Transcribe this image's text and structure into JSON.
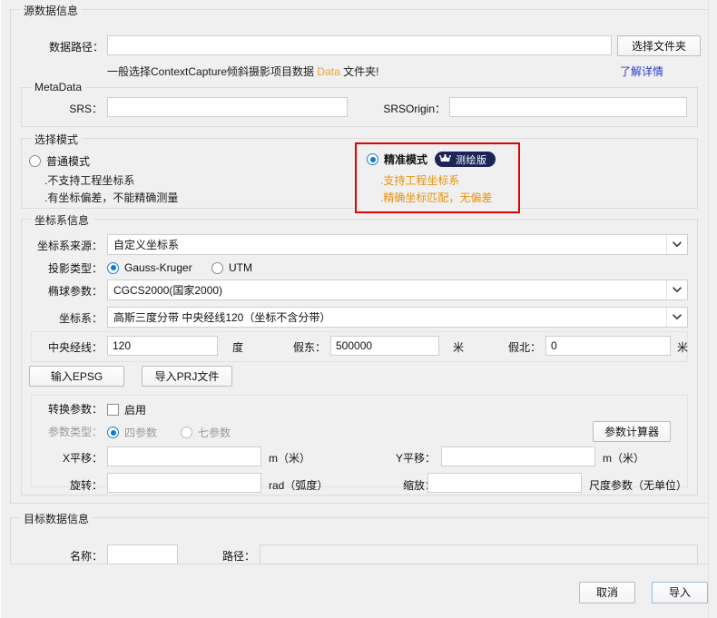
{
  "source_group": {
    "legend": "源数据信息",
    "data_path_label": "数据路径：",
    "data_path_value": "",
    "choose_folder_button": "选择文件夹",
    "hint_prefix": "一般选择ContextCapture倾斜摄影项目数据 ",
    "hint_accent": "Data",
    "hint_suffix": " 文件夹!",
    "learn_more_link": "了解详情",
    "metadata": {
      "legend": "MetaData",
      "srs_label": "SRS：",
      "srs_value": "",
      "srsorigin_label": "SRSOrigin：",
      "srsorigin_value": ""
    },
    "mode": {
      "legend": "选择模式",
      "normal": {
        "label": "普通模式",
        "selected": false,
        "bullets": [
          ".不支持工程坐标系",
          ".有坐标偏差，不能精确测量"
        ]
      },
      "precise": {
        "label": "精准模式",
        "selected": true,
        "badge_text": "测绘版",
        "badge_icon": "crown-icon",
        "badge_color": "#1b2559",
        "highlight_color": "#e60000",
        "bullets": [
          ".支持工程坐标系",
          ".精确坐标匹配，无偏差"
        ],
        "bullet_color": "#e8920c"
      }
    },
    "crs": {
      "legend": "坐标系信息",
      "source_label": "坐标系来源：",
      "source_value": "自定义坐标系",
      "projection_label": "投影类型：",
      "projection_options": [
        "Gauss-Kruger",
        "UTM"
      ],
      "projection_selected": "Gauss-Kruger",
      "ellipsoid_label": "椭球参数：",
      "ellipsoid_value": "CGCS2000(国家2000)",
      "coordsys_label": "坐标系：",
      "coordsys_value": "高斯三度分带 中央经线120（坐标不含分带）",
      "central_meridian_label": "中央经线：",
      "central_meridian_value": "120",
      "central_meridian_unit": "度",
      "false_east_label": "假东：",
      "false_east_value": "500000",
      "false_east_unit": "米",
      "false_north_label": "假北：",
      "false_north_value": "0",
      "false_north_unit": "米",
      "epsg_button": "输入EPSG",
      "prj_button": "导入PRJ文件",
      "transform": {
        "params_label": "转换参数：",
        "enable_label": "启用",
        "enable_checked": false,
        "type_label": "参数类型：",
        "type_options": [
          "四参数",
          "七参数"
        ],
        "type_selected": "四参数",
        "calculator_button": "参数计算器",
        "x_shift_label": "X平移：",
        "x_shift_value": "",
        "x_shift_unit": "m（米）",
        "y_shift_label": "Y平移：",
        "y_shift_value": "",
        "y_shift_unit": "m（米）",
        "rotate_label": "旋转：",
        "rotate_value": "",
        "rotate_unit": "rad（弧度）",
        "scale_label": "缩放：",
        "scale_value": "",
        "scale_unit": "尺度参数（无单位）"
      }
    }
  },
  "target_group": {
    "legend": "目标数据信息",
    "name_label": "名称：",
    "name_value": "",
    "path_label": "路径：",
    "path_value": ""
  },
  "footer": {
    "cancel_button": "取消",
    "import_button": "导入"
  }
}
